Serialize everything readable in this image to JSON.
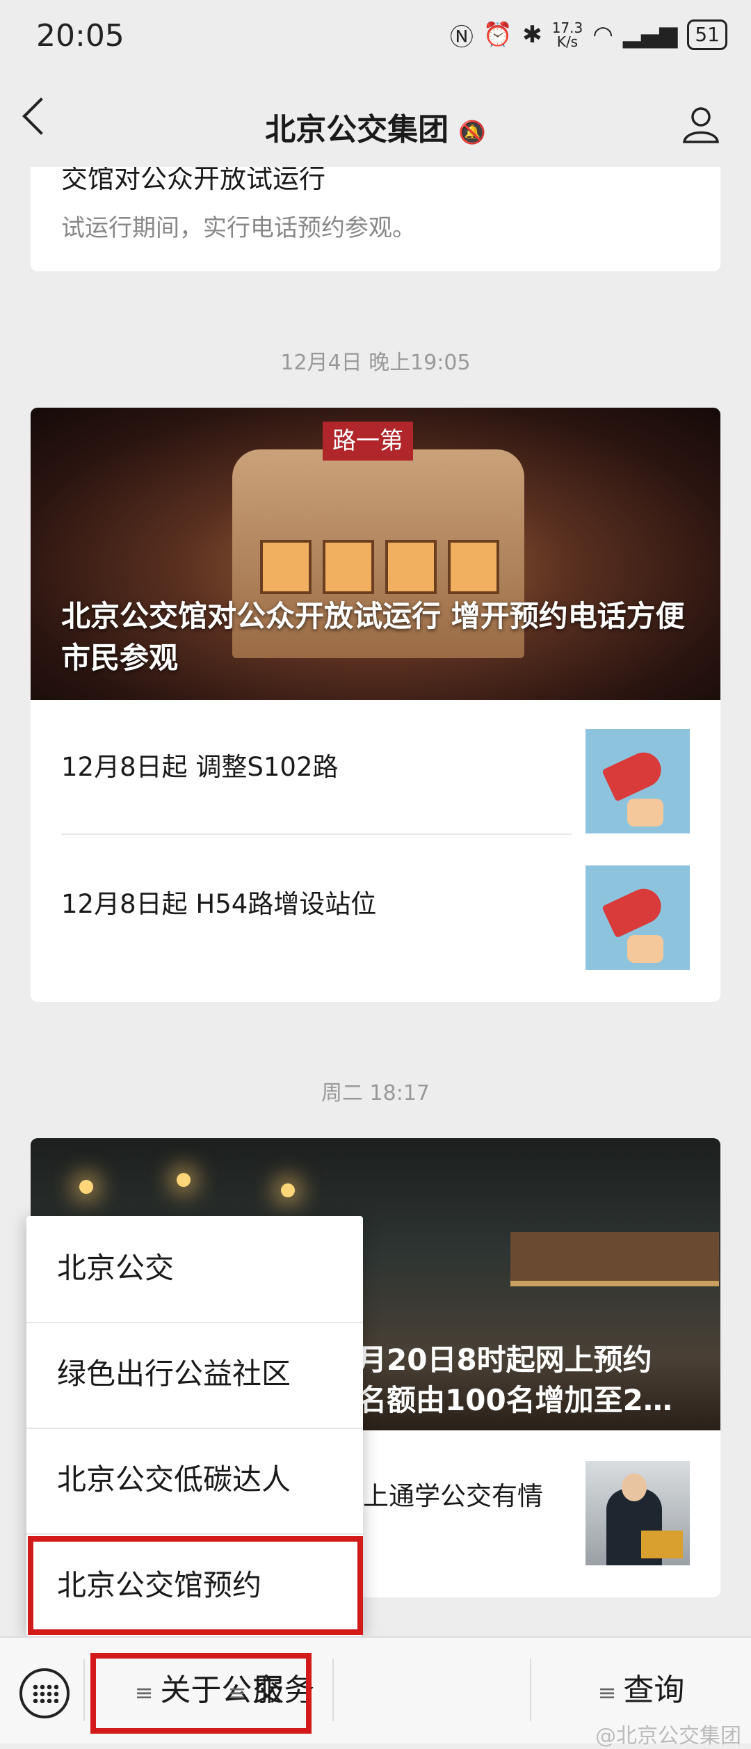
{
  "status_bar": {
    "time": "20:05",
    "net_speed_value": "17.3",
    "net_speed_unit": "K/s",
    "battery": "51"
  },
  "nav": {
    "title": "北京公交集团"
  },
  "top_card": {
    "title_fragment": "交馆对公众开放试运行",
    "desc": "试运行期间，实行电话预约参观。"
  },
  "msg1": {
    "time": "12月4日 晚上19:05",
    "hero_title": "北京公交馆对公众开放试运行  增开预约电话方便市民参观",
    "hero_sign": "路一第",
    "items": [
      {
        "title": "12月8日起  调整S102路"
      },
      {
        "title": "12月8日起  H54路增设站位"
      }
    ]
  },
  "msg2": {
    "time": "周二 18:17",
    "hero_title_line1": "月20日8时起网上预约",
    "hero_title_line2": "名额由100名增加至2…",
    "item_title": "上通学公交有情"
  },
  "popup_menu": {
    "items": [
      "北京公交",
      "绿色出行公益社区",
      "北京公交低碳达人",
      "北京公交馆预约"
    ],
    "highlighted": "北京公交馆预约"
  },
  "bottom_menu": {
    "tabs": [
      "关于公交",
      "服务",
      "查询"
    ],
    "highlighted": "关于公交"
  },
  "watermark": "@北京公交集团",
  "colors": {
    "highlight_border": "#d21a1a",
    "background": "#ededed"
  }
}
